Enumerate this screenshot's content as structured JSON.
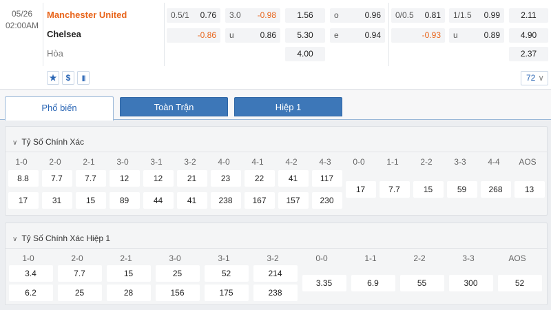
{
  "match": {
    "date": "05/26",
    "time": "02:00AM",
    "home": "Manchester United",
    "away": "Chelsea",
    "draw": "Hòa",
    "ft_handicap": {
      "home": {
        "line": "0.5/1",
        "odds": "0.76"
      },
      "away": {
        "odds": "-0.86"
      }
    },
    "ft_overunder": {
      "over": {
        "line": "3.0",
        "odds": "-0.98"
      },
      "under": {
        "label": "u",
        "odds": "0.86"
      }
    },
    "ft_1x2": {
      "home": "1.56",
      "away": "5.30",
      "draw": "4.00"
    },
    "ft_oddeven": {
      "odd": {
        "label": "o",
        "odds": "0.96"
      },
      "even": {
        "label": "e",
        "odds": "0.94"
      }
    },
    "h1_handicap": {
      "home": {
        "line": "0/0.5",
        "odds": "0.81"
      },
      "away": {
        "odds": "-0.93"
      }
    },
    "h1_overunder": {
      "over": {
        "line": "1/1.5",
        "odds": "0.99"
      },
      "under": {
        "label": "u",
        "odds": "0.89"
      }
    },
    "h1_1x2": {
      "home": "2.11",
      "away": "4.90",
      "draw": "2.37"
    },
    "tools": {
      "favorite": "★",
      "odds": "$",
      "stats": "|||"
    },
    "more_markets": "72",
    "more_chev": "∨"
  },
  "tabs": [
    {
      "label": "Phổ biến",
      "active": true
    },
    {
      "label": "Toàn Trận",
      "active": false
    },
    {
      "label": "Hiệp 1",
      "active": false
    }
  ],
  "cs_ft": {
    "title": "Tỷ Số Chính Xác",
    "chev": "∨",
    "pairs": [
      {
        "home": "1-0",
        "home_odds": "8.8",
        "away_odds": "17"
      },
      {
        "home": "2-0",
        "home_odds": "7.7",
        "away_odds": "31"
      },
      {
        "home": "2-1",
        "home_odds": "7.7",
        "away_odds": "15"
      },
      {
        "home": "3-0",
        "home_odds": "12",
        "away_odds": "89"
      },
      {
        "home": "3-1",
        "home_odds": "12",
        "away_odds": "44"
      },
      {
        "home": "3-2",
        "home_odds": "21",
        "away_odds": "41"
      },
      {
        "home": "4-0",
        "home_odds": "23",
        "away_odds": "238"
      },
      {
        "home": "4-1",
        "home_odds": "22",
        "away_odds": "167"
      },
      {
        "home": "4-2",
        "home_odds": "41",
        "away_odds": "157"
      },
      {
        "home": "4-3",
        "home_odds": "117",
        "away_odds": "230"
      }
    ],
    "singles": [
      {
        "label": "0-0",
        "odds": "17"
      },
      {
        "label": "1-1",
        "odds": "7.7"
      },
      {
        "label": "2-2",
        "odds": "15"
      },
      {
        "label": "3-3",
        "odds": "59"
      },
      {
        "label": "4-4",
        "odds": "268"
      },
      {
        "label": "AOS",
        "odds": "13"
      }
    ]
  },
  "cs_h1": {
    "title": "Tỷ Số Chính Xác Hiệp 1",
    "chev": "∨",
    "pairs": [
      {
        "home": "1-0",
        "home_odds": "3.4",
        "away_odds": "6.2"
      },
      {
        "home": "2-0",
        "home_odds": "7.7",
        "away_odds": "25"
      },
      {
        "home": "2-1",
        "home_odds": "15",
        "away_odds": "28"
      },
      {
        "home": "3-0",
        "home_odds": "25",
        "away_odds": "156"
      },
      {
        "home": "3-1",
        "home_odds": "52",
        "away_odds": "175"
      },
      {
        "home": "3-2",
        "home_odds": "214",
        "away_odds": "238"
      }
    ],
    "singles": [
      {
        "label": "0-0",
        "odds": "3.35"
      },
      {
        "label": "1-1",
        "odds": "6.9"
      },
      {
        "label": "2-2",
        "odds": "55"
      },
      {
        "label": "3-3",
        "odds": "300"
      },
      {
        "label": "AOS",
        "odds": "52"
      }
    ]
  },
  "colors": {
    "accent": "#2a66b5",
    "negative": "#e8641a",
    "tab_blue": "#3d77b8"
  }
}
